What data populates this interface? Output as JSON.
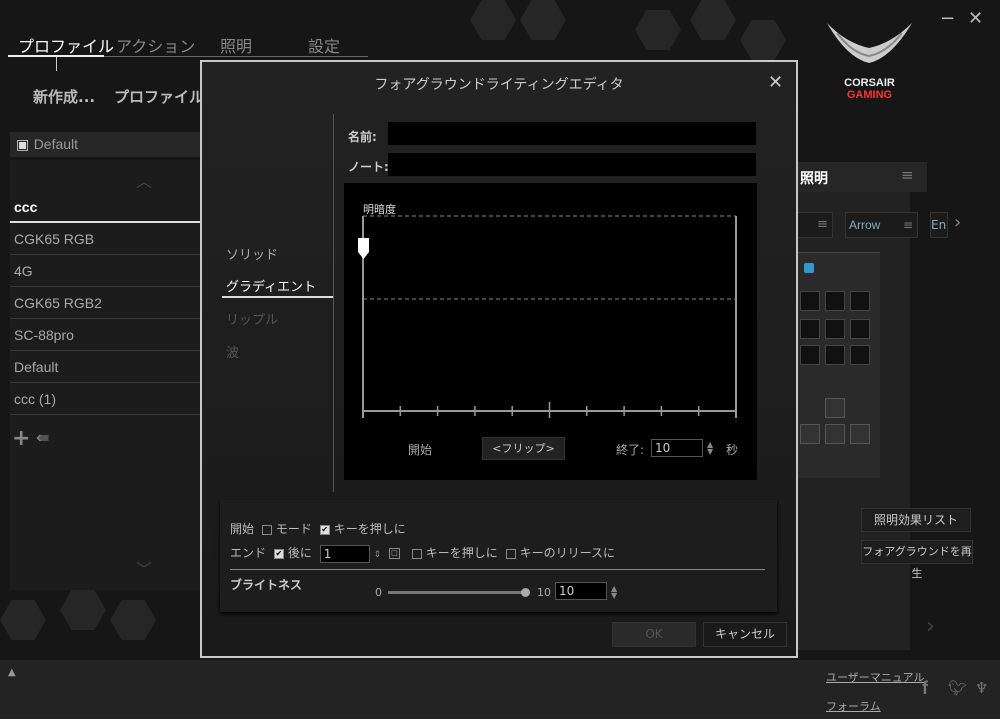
{
  "tabs": [
    "プロファイル",
    "アクション",
    "照明",
    "設定"
  ],
  "toolbar": {
    "new": "新作成...",
    "profile": "プロファイルの"
  },
  "profile_header": "Default",
  "profiles": [
    "ccc",
    "CGK65 RGB",
    "4G",
    "CGK65 RGB2",
    "SC-88pro",
    "Default",
    "ccc (1)"
  ],
  "logo": {
    "line1": "CORSAIR",
    "line2": "GAMING"
  },
  "right_panel": {
    "title": "照明",
    "dropdown1": "",
    "dropdown2": "Arrow",
    "dropdown3": "En",
    "effects_list": "照明効果リスト",
    "play_foreground": "フォアグラウンドを再生"
  },
  "dialog": {
    "title": "フォアグラウンドライティングエディタ",
    "menu": [
      "ソリッド",
      "グラディエント",
      "リップル",
      "波"
    ],
    "name_label": "名前:",
    "name_value": "",
    "note_label": "ノート:",
    "note_value": "",
    "graph": {
      "ylabel": "明暗度",
      "start": "開始",
      "flip": "<フリップ>",
      "end_label": "終了:",
      "end_value": "10",
      "unit": "秒"
    },
    "start_row": {
      "label": "開始",
      "mode": "モード",
      "mode_checked": false,
      "keypress": "キーを押しに",
      "keypress_checked": true
    },
    "end_row": {
      "label": "エンド",
      "after": "後に",
      "after_checked": true,
      "after_value": "1",
      "keypress": "キーを押しに",
      "release": "キーのリリースに"
    },
    "brightness": {
      "label": "ブライトネス",
      "min": "0",
      "max": "10",
      "value": "10",
      "fraction": 1.0
    },
    "ok": "OK",
    "cancel": "キャンセル"
  },
  "footer": {
    "manual": "ユーザーマニュアル",
    "forum": "フォーラム"
  }
}
